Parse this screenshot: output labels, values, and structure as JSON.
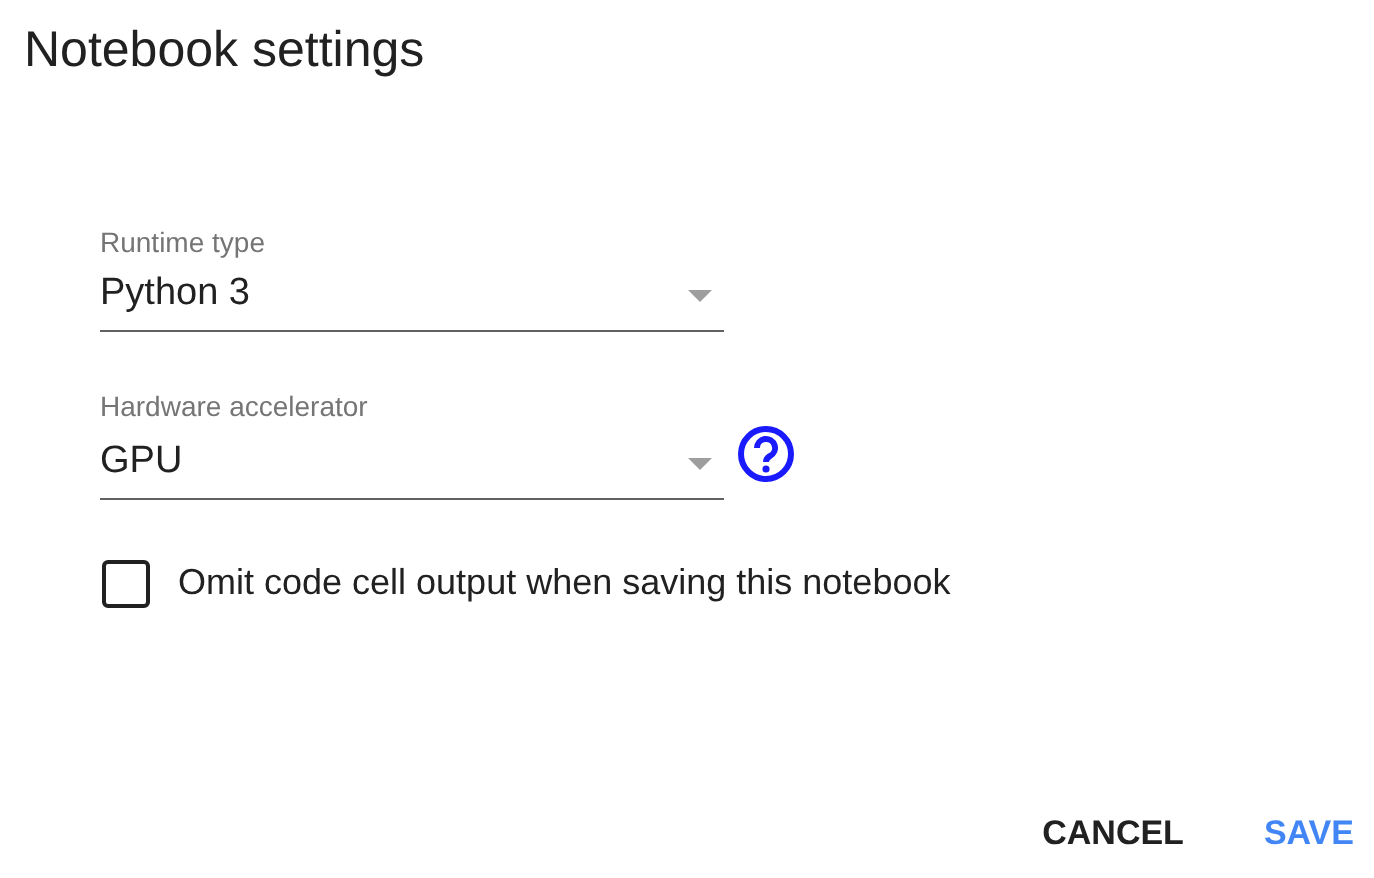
{
  "dialog": {
    "title": "Notebook settings"
  },
  "fields": [
    {
      "label": "Runtime type",
      "value": "Python 3",
      "help": false
    },
    {
      "label": "Hardware accelerator",
      "value": "GPU",
      "help": true
    }
  ],
  "checkbox": {
    "label": "Omit code cell output when saving this notebook",
    "checked": false
  },
  "buttons": [
    {
      "label": "CANCEL",
      "kind": "secondary"
    },
    {
      "label": "SAVE",
      "kind": "primary"
    }
  ]
}
